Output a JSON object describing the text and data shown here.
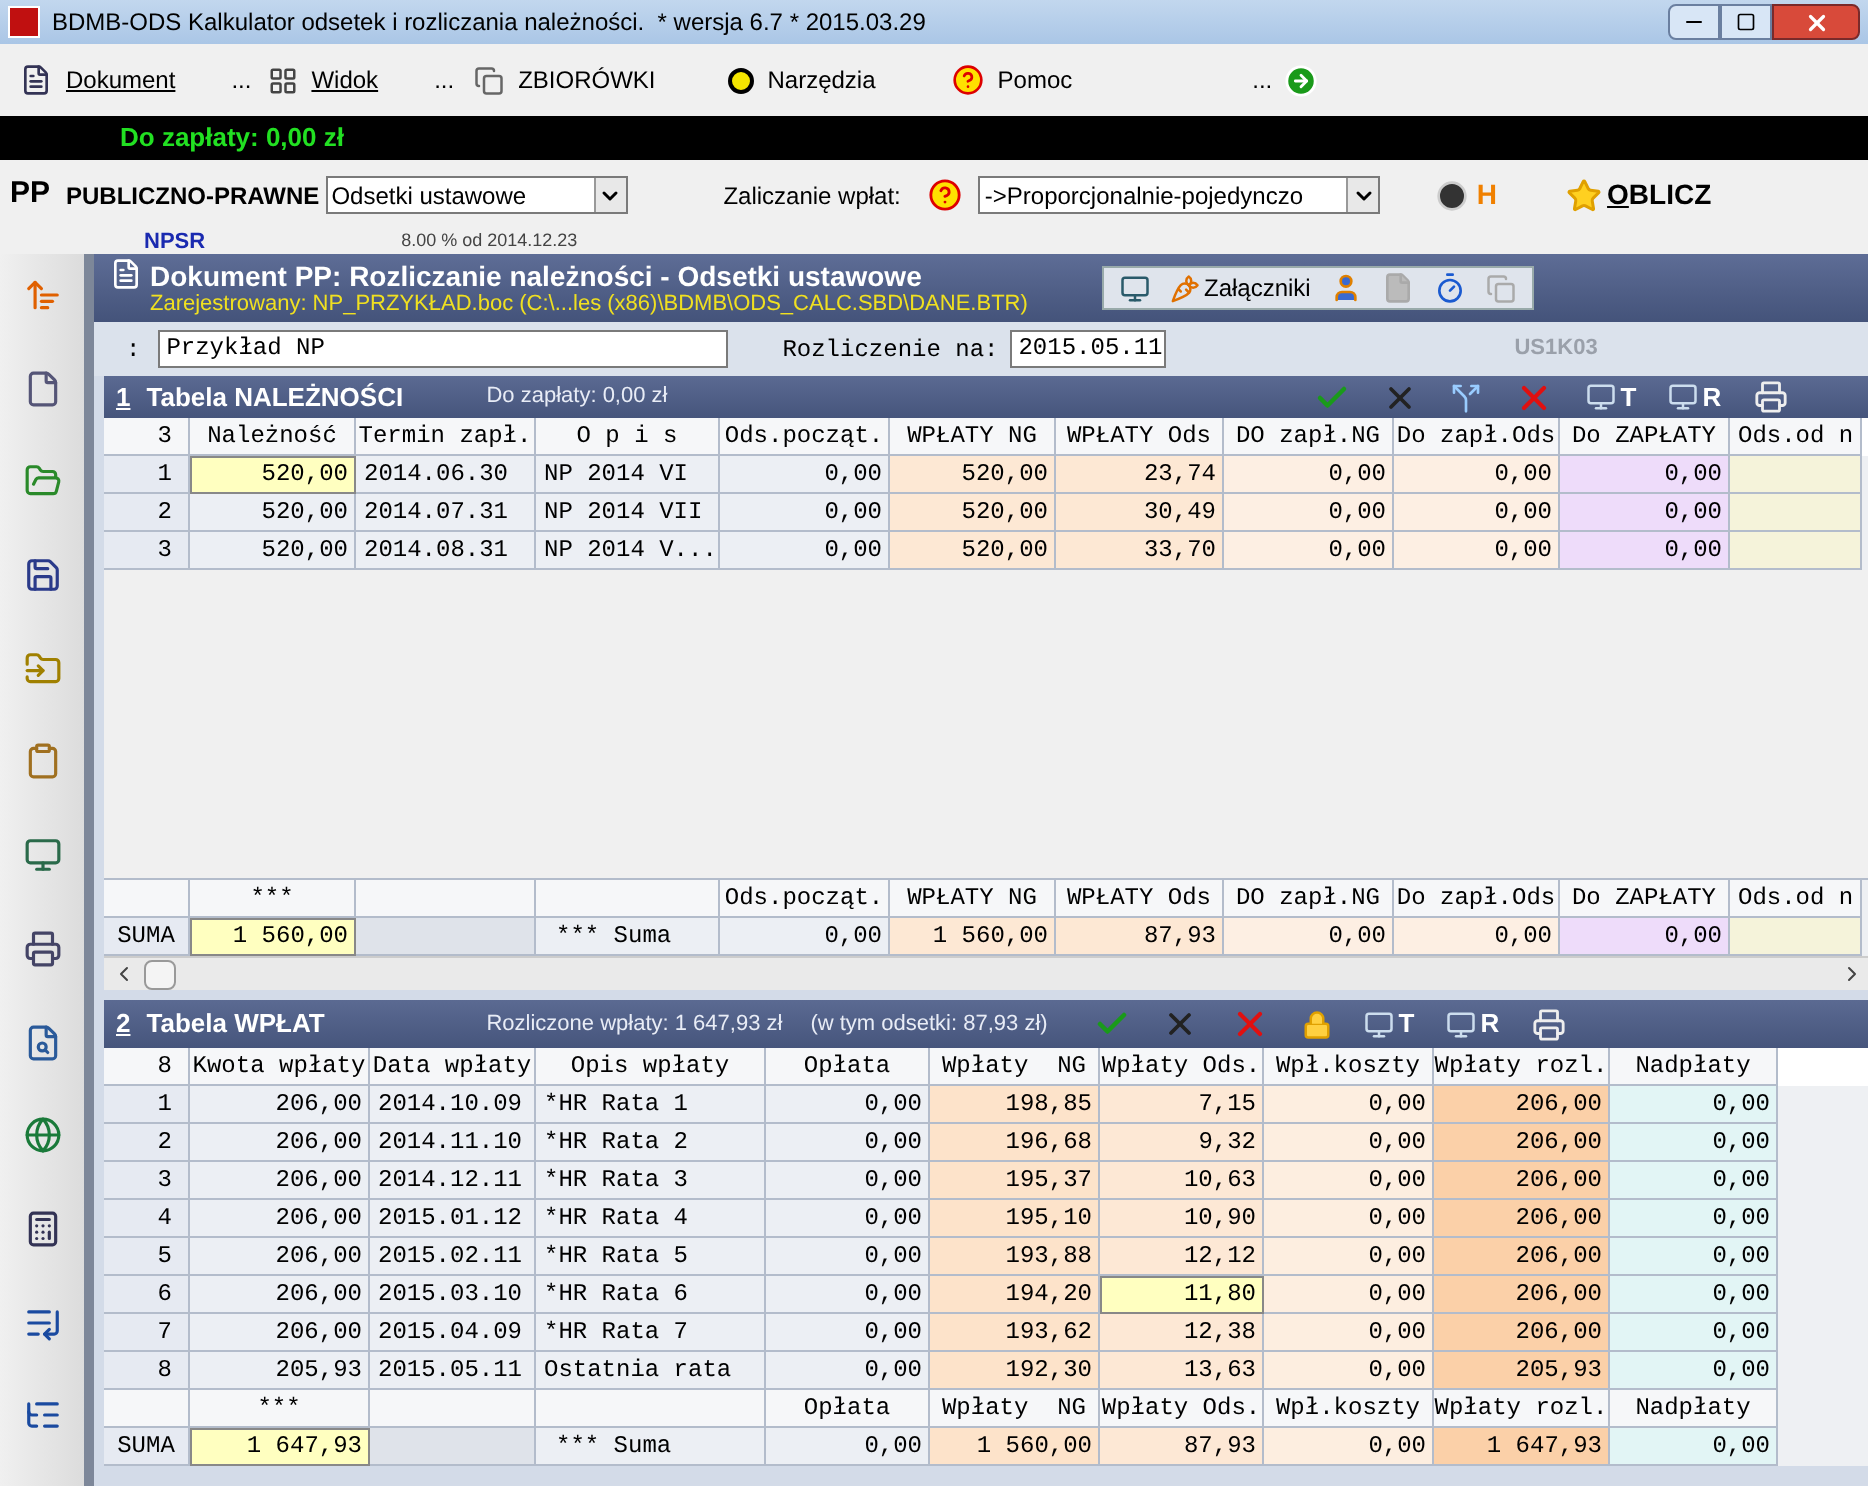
{
  "window": {
    "title": "BDMB-ODS Kalkulator odsetek i rozliczania należności.  * wersja 6.7 * 2015.03.29"
  },
  "menu": [
    {
      "kind": "item",
      "label": "Dokument",
      "underlined": true
    },
    {
      "kind": "dots",
      "label": "..."
    },
    {
      "kind": "item",
      "label": "Widok",
      "underlined": true
    },
    {
      "kind": "dots",
      "label": "..."
    },
    {
      "kind": "item",
      "label": "ZBIORÓWKI",
      "underlined": false
    },
    {
      "kind": "item",
      "label": "Narzędzia",
      "underlined": false
    },
    {
      "kind": "item",
      "label": "Pomoc",
      "underlined": false
    },
    {
      "kind": "dots",
      "label": "..."
    },
    {
      "kind": "go"
    }
  ],
  "due_bar": {
    "text": "Do zapłaty: 0,00 zł"
  },
  "mode_bar": {
    "code": "PP",
    "name": "PUBLICZNO-PRAWNE",
    "interest_select": "Odsetki ustawowe",
    "allocation_label": "Zaliczanie wpłat:",
    "allocation_select": "->Proporcjonalnie-pojedynczo",
    "history_label": "H",
    "calculate": "OBLICZ"
  },
  "rate_bar": {
    "code": "NPSR",
    "rate": "8.00 % od 2014.12.23"
  },
  "document": {
    "title": "Dokument PP: Rozliczanie należności - Odsetki ustawowe",
    "registered": "Zarejestrowany: NP_PRZYKŁAD.boc (C:\\...les (x86)\\BDMB\\ODS_CALC.SBD\\DANE.BTR)",
    "attachments": "Załączniki",
    "name_label": ":",
    "name_value": "Przykład NP",
    "date_label": "Rozliczenie na:",
    "date_value": "2015.05.11",
    "code": "US1K03"
  },
  "tables": [
    {
      "number": "1",
      "title": "Tabela NALEŻNOŚCI",
      "info": [
        "Do zapłaty: 0,00 zł"
      ],
      "tools": [
        {
          "kind": "check"
        },
        {
          "kind": "strike"
        },
        {
          "kind": "fork"
        },
        {
          "kind": "delete"
        },
        {
          "kind": "report",
          "label": "T"
        },
        {
          "kind": "report",
          "label": "R"
        },
        {
          "kind": "print"
        }
      ],
      "row_count": "3",
      "columns": [
        {
          "label": "Należność",
          "kind": "number",
          "color": "#eceff4"
        },
        {
          "label": "Termin zapł.",
          "kind": "text",
          "color": "#eceff4"
        },
        {
          "label": "O p i s",
          "kind": "text",
          "color": "#eceff4"
        },
        {
          "label": "Ods.począt.",
          "kind": "number",
          "color": "#eceff4"
        },
        {
          "label": "WPŁATY NG",
          "kind": "number",
          "color": "#fde8d4"
        },
        {
          "label": "WPŁATY Ods",
          "kind": "number",
          "color": "#fde8d4"
        },
        {
          "label": "DO zapł.NG",
          "kind": "number",
          "color": "#fdefe3"
        },
        {
          "label": "Do zapł.Ods",
          "kind": "number",
          "color": "#fdefe3"
        },
        {
          "label": "Do ZAPŁATY",
          "kind": "number",
          "color": "#eedcfa"
        },
        {
          "label": "Ods.od n",
          "kind": "cut",
          "color": "#f5f3da"
        }
      ],
      "rows": [
        {
          "number": "1",
          "cells": [
            {
              "text": "520,00",
              "selected": true
            },
            {
              "text": "2014.06.30",
              "selected": false
            },
            {
              "text": "NP 2014 VI",
              "selected": false
            },
            {
              "text": "0,00",
              "selected": false
            },
            {
              "text": "520,00",
              "selected": false
            },
            {
              "text": "23,74",
              "selected": false
            },
            {
              "text": "0,00",
              "selected": false
            },
            {
              "text": "0,00",
              "selected": false
            },
            {
              "text": "0,00",
              "selected": false
            }
          ]
        },
        {
          "number": "2",
          "cells": [
            {
              "text": "520,00",
              "selected": false
            },
            {
              "text": "2014.07.31",
              "selected": false
            },
            {
              "text": "NP 2014 VII",
              "selected": false
            },
            {
              "text": "0,00",
              "selected": false
            },
            {
              "text": "520,00",
              "selected": false
            },
            {
              "text": "30,49",
              "selected": false
            },
            {
              "text": "0,00",
              "selected": false
            },
            {
              "text": "0,00",
              "selected": false
            },
            {
              "text": "0,00",
              "selected": false
            }
          ]
        },
        {
          "number": "3",
          "cells": [
            {
              "text": "520,00",
              "selected": false
            },
            {
              "text": "2014.08.31",
              "selected": false
            },
            {
              "text": "NP 2014 V...",
              "selected": false
            },
            {
              "text": "0,00",
              "selected": false
            },
            {
              "text": "520,00",
              "selected": false
            },
            {
              "text": "33,70",
              "selected": false
            },
            {
              "text": "0,00",
              "selected": false
            },
            {
              "text": "0,00",
              "selected": false
            },
            {
              "text": "0,00",
              "selected": false
            }
          ]
        }
      ],
      "footer": {
        "label": "SUMA",
        "cells": [
          {
            "header": "***",
            "sum": "1 560,00",
            "selected": true
          },
          {
            "selected": false
          },
          {
            "sum": "*** Suma",
            "selected": false
          },
          {
            "header": "Ods.począt.",
            "sum": "0,00",
            "selected": false
          },
          {
            "header": "WPŁATY NG",
            "sum": "1 560,00",
            "selected": false
          },
          {
            "header": "WPŁATY Ods",
            "sum": "87,93",
            "selected": false
          },
          {
            "header": "DO zapł.NG",
            "sum": "0,00",
            "selected": false
          },
          {
            "header": "Do zapł.Ods",
            "sum": "0,00",
            "selected": false
          },
          {
            "header": "Do ZAPŁATY",
            "sum": "0,00",
            "selected": false
          },
          {
            "header": "Ods.od n",
            "selected": false
          }
        ]
      },
      "scrollbar": true
    },
    {
      "number": "2",
      "title": "Tabela WPŁAT",
      "info": [
        "Rozliczone wpłaty: 1 647,93 zł",
        "(w tym odsetki: 87,93 zł)"
      ],
      "tools": [
        {
          "kind": "check"
        },
        {
          "kind": "strike"
        },
        {
          "kind": "delete"
        },
        {
          "kind": "lock"
        },
        {
          "kind": "report",
          "label": "T"
        },
        {
          "kind": "report",
          "label": "R"
        },
        {
          "kind": "print"
        }
      ],
      "row_count": "8",
      "columns": [
        {
          "label": "Kwota wpłaty",
          "kind": "number",
          "color": "#eceff4"
        },
        {
          "label": "Data wpłaty",
          "kind": "text",
          "color": "#eceff4"
        },
        {
          "label": "Opis wpłaty",
          "kind": "wide",
          "color": "#eceff4"
        },
        {
          "label": "Opłata",
          "kind": "number",
          "color": "#eceff4"
        },
        {
          "label": "Wpłaty  NG",
          "kind": "number",
          "color": "#fde3ca"
        },
        {
          "label": "Wpłaty Ods.",
          "kind": "number",
          "color": "#fde8d5"
        },
        {
          "label": "Wpł.koszty",
          "kind": "number",
          "color": "#fdeee0"
        },
        {
          "label": "Wpłaty rozl.",
          "kind": "number",
          "color": "#fbd0a8"
        },
        {
          "label": "Nadpłaty",
          "kind": "number",
          "color": "#e2f5f5"
        }
      ],
      "rows": [
        {
          "number": "1",
          "cells": [
            {
              "text": "206,00",
              "selected": false
            },
            {
              "text": "2014.10.09",
              "selected": false
            },
            {
              "text": "*HR Rata 1",
              "selected": false
            },
            {
              "text": "0,00",
              "selected": false
            },
            {
              "text": "198,85",
              "selected": false
            },
            {
              "text": "7,15",
              "selected": false
            },
            {
              "text": "0,00",
              "selected": false
            },
            {
              "text": "206,00",
              "selected": false
            },
            {
              "text": "0,00",
              "selected": false
            }
          ]
        },
        {
          "number": "2",
          "cells": [
            {
              "text": "206,00",
              "selected": false
            },
            {
              "text": "2014.11.10",
              "selected": false
            },
            {
              "text": "*HR Rata 2",
              "selected": false
            },
            {
              "text": "0,00",
              "selected": false
            },
            {
              "text": "196,68",
              "selected": false
            },
            {
              "text": "9,32",
              "selected": false
            },
            {
              "text": "0,00",
              "selected": false
            },
            {
              "text": "206,00",
              "selected": false
            },
            {
              "text": "0,00",
              "selected": false
            }
          ]
        },
        {
          "number": "3",
          "cells": [
            {
              "text": "206,00",
              "selected": false
            },
            {
              "text": "2014.12.11",
              "selected": false
            },
            {
              "text": "*HR Rata 3",
              "selected": false
            },
            {
              "text": "0,00",
              "selected": false
            },
            {
              "text": "195,37",
              "selected": false
            },
            {
              "text": "10,63",
              "selected": false
            },
            {
              "text": "0,00",
              "selected": false
            },
            {
              "text": "206,00",
              "selected": false
            },
            {
              "text": "0,00",
              "selected": false
            }
          ]
        },
        {
          "number": "4",
          "cells": [
            {
              "text": "206,00",
              "selected": false
            },
            {
              "text": "2015.01.12",
              "selected": false
            },
            {
              "text": "*HR Rata 4",
              "selected": false
            },
            {
              "text": "0,00",
              "selected": false
            },
            {
              "text": "195,10",
              "selected": false
            },
            {
              "text": "10,90",
              "selected": false
            },
            {
              "text": "0,00",
              "selected": false
            },
            {
              "text": "206,00",
              "selected": false
            },
            {
              "text": "0,00",
              "selected": false
            }
          ]
        },
        {
          "number": "5",
          "cells": [
            {
              "text": "206,00",
              "selected": false
            },
            {
              "text": "2015.02.11",
              "selected": false
            },
            {
              "text": "*HR Rata 5",
              "selected": false
            },
            {
              "text": "0,00",
              "selected": false
            },
            {
              "text": "193,88",
              "selected": false
            },
            {
              "text": "12,12",
              "selected": false
            },
            {
              "text": "0,00",
              "selected": false
            },
            {
              "text": "206,00",
              "selected": false
            },
            {
              "text": "0,00",
              "selected": false
            }
          ]
        },
        {
          "number": "6",
          "cells": [
            {
              "text": "206,00",
              "selected": false
            },
            {
              "text": "2015.03.10",
              "selected": false
            },
            {
              "text": "*HR Rata 6",
              "selected": false
            },
            {
              "text": "0,00",
              "selected": false
            },
            {
              "text": "194,20",
              "selected": false
            },
            {
              "text": "11,80",
              "selected": true
            },
            {
              "text": "0,00",
              "selected": false
            },
            {
              "text": "206,00",
              "selected": false
            },
            {
              "text": "0,00",
              "selected": false
            }
          ]
        },
        {
          "number": "7",
          "cells": [
            {
              "text": "206,00",
              "selected": false
            },
            {
              "text": "2015.04.09",
              "selected": false
            },
            {
              "text": "*HR Rata 7",
              "selected": false
            },
            {
              "text": "0,00",
              "selected": false
            },
            {
              "text": "193,62",
              "selected": false
            },
            {
              "text": "12,38",
              "selected": false
            },
            {
              "text": "0,00",
              "selected": false
            },
            {
              "text": "206,00",
              "selected": false
            },
            {
              "text": "0,00",
              "selected": false
            }
          ]
        },
        {
          "number": "8",
          "cells": [
            {
              "text": "205,93",
              "selected": false
            },
            {
              "text": "2015.05.11",
              "selected": false
            },
            {
              "text": "Ostatnia rata",
              "selected": false
            },
            {
              "text": "0,00",
              "selected": false
            },
            {
              "text": "192,30",
              "selected": false
            },
            {
              "text": "13,63",
              "selected": false
            },
            {
              "text": "0,00",
              "selected": false
            },
            {
              "text": "205,93",
              "selected": false
            },
            {
              "text": "0,00",
              "selected": false
            }
          ]
        }
      ],
      "footer": {
        "label": "SUMA",
        "cells": [
          {
            "header": "***",
            "sum": "1 647,93",
            "selected": true
          },
          {
            "selected": false
          },
          {
            "sum": "*** Suma",
            "selected": false
          },
          {
            "header": "Opłata",
            "sum": "0,00",
            "selected": false
          },
          {
            "header": "Wpłaty  NG",
            "sum": "1 560,00",
            "selected": false
          },
          {
            "header": "Wpłaty Ods.",
            "sum": "87,93",
            "selected": false
          },
          {
            "header": "Wpł.koszty",
            "sum": "0,00",
            "selected": false
          },
          {
            "header": "Wpłaty rozl.",
            "sum": "1 647,93",
            "selected": false
          },
          {
            "header": "Nadpłaty",
            "sum": "0,00",
            "selected": false
          }
        ]
      },
      "scrollbar": false
    }
  ]
}
